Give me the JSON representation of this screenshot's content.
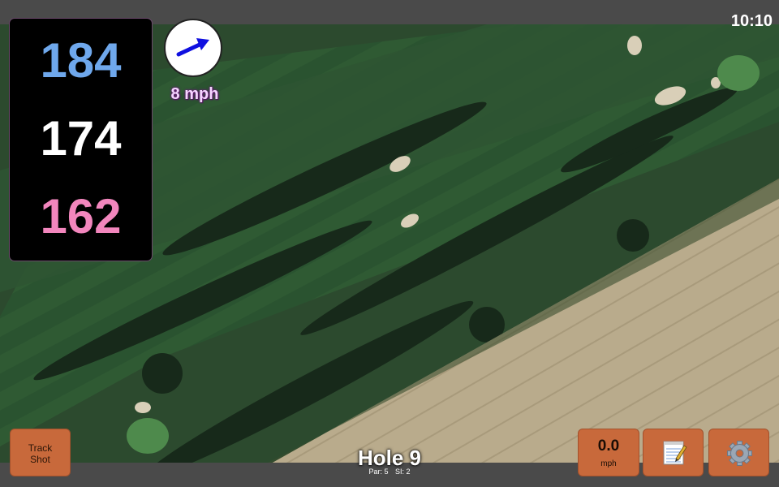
{
  "status": {
    "time": "10:10"
  },
  "distances": {
    "back": "184",
    "middle": "174",
    "front": "162"
  },
  "wind": {
    "speed": "8 mph",
    "direction_icon": "arrow-icon"
  },
  "hole": {
    "title": "Hole 9",
    "par_label": "Par: 5",
    "si_label": "SI: 2"
  },
  "buttons": {
    "track_line1": "Track",
    "track_line2": "Shot",
    "speed_value": "0.0",
    "speed_unit": "mph",
    "notes_icon": "notepad-icon",
    "settings_icon": "gear-icon"
  },
  "colors": {
    "back_distance": "#6fa8ec",
    "middle_distance": "#ffffff",
    "front_distance": "#f286bd",
    "button": "#c8693b",
    "wind_arrow": "#1010e0"
  }
}
